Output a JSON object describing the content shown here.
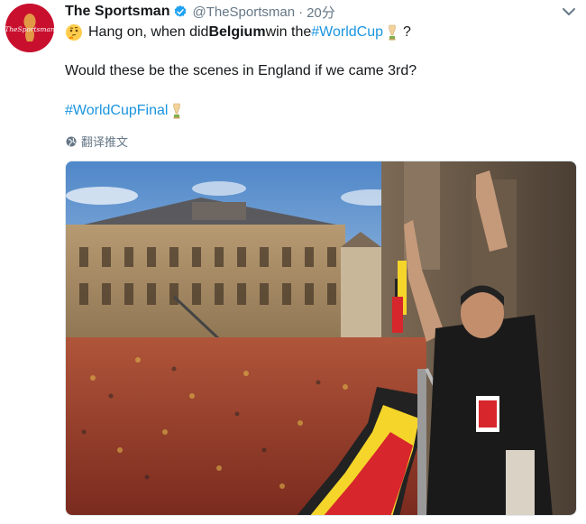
{
  "tweet": {
    "display_name": "The Sportsman",
    "handle": "@TheSportsman",
    "separator": "·",
    "timestamp": "20分",
    "verified": true,
    "avatar": {
      "text": "TheSportsman",
      "color": "#c8102e",
      "icon": "world-cup-logo"
    },
    "text": {
      "line1_prefix": "Hang on, when did ",
      "line1_bold": "Belgium",
      "line1_middle": " win the ",
      "line1_hashtag": "#WorldCup",
      "line1_suffix": "?",
      "line2": "Would these be the scenes in England if we came 3rd?",
      "line3_hashtag": "#WorldCupFinal"
    },
    "translate_label": "翻译推文",
    "media": {
      "type": "photo",
      "description_icon": "celebration-photo"
    }
  },
  "colors": {
    "link": "#1b95e0",
    "secondary_text": "#657786",
    "primary_text": "#14171a",
    "verified": "#1da1f2"
  }
}
